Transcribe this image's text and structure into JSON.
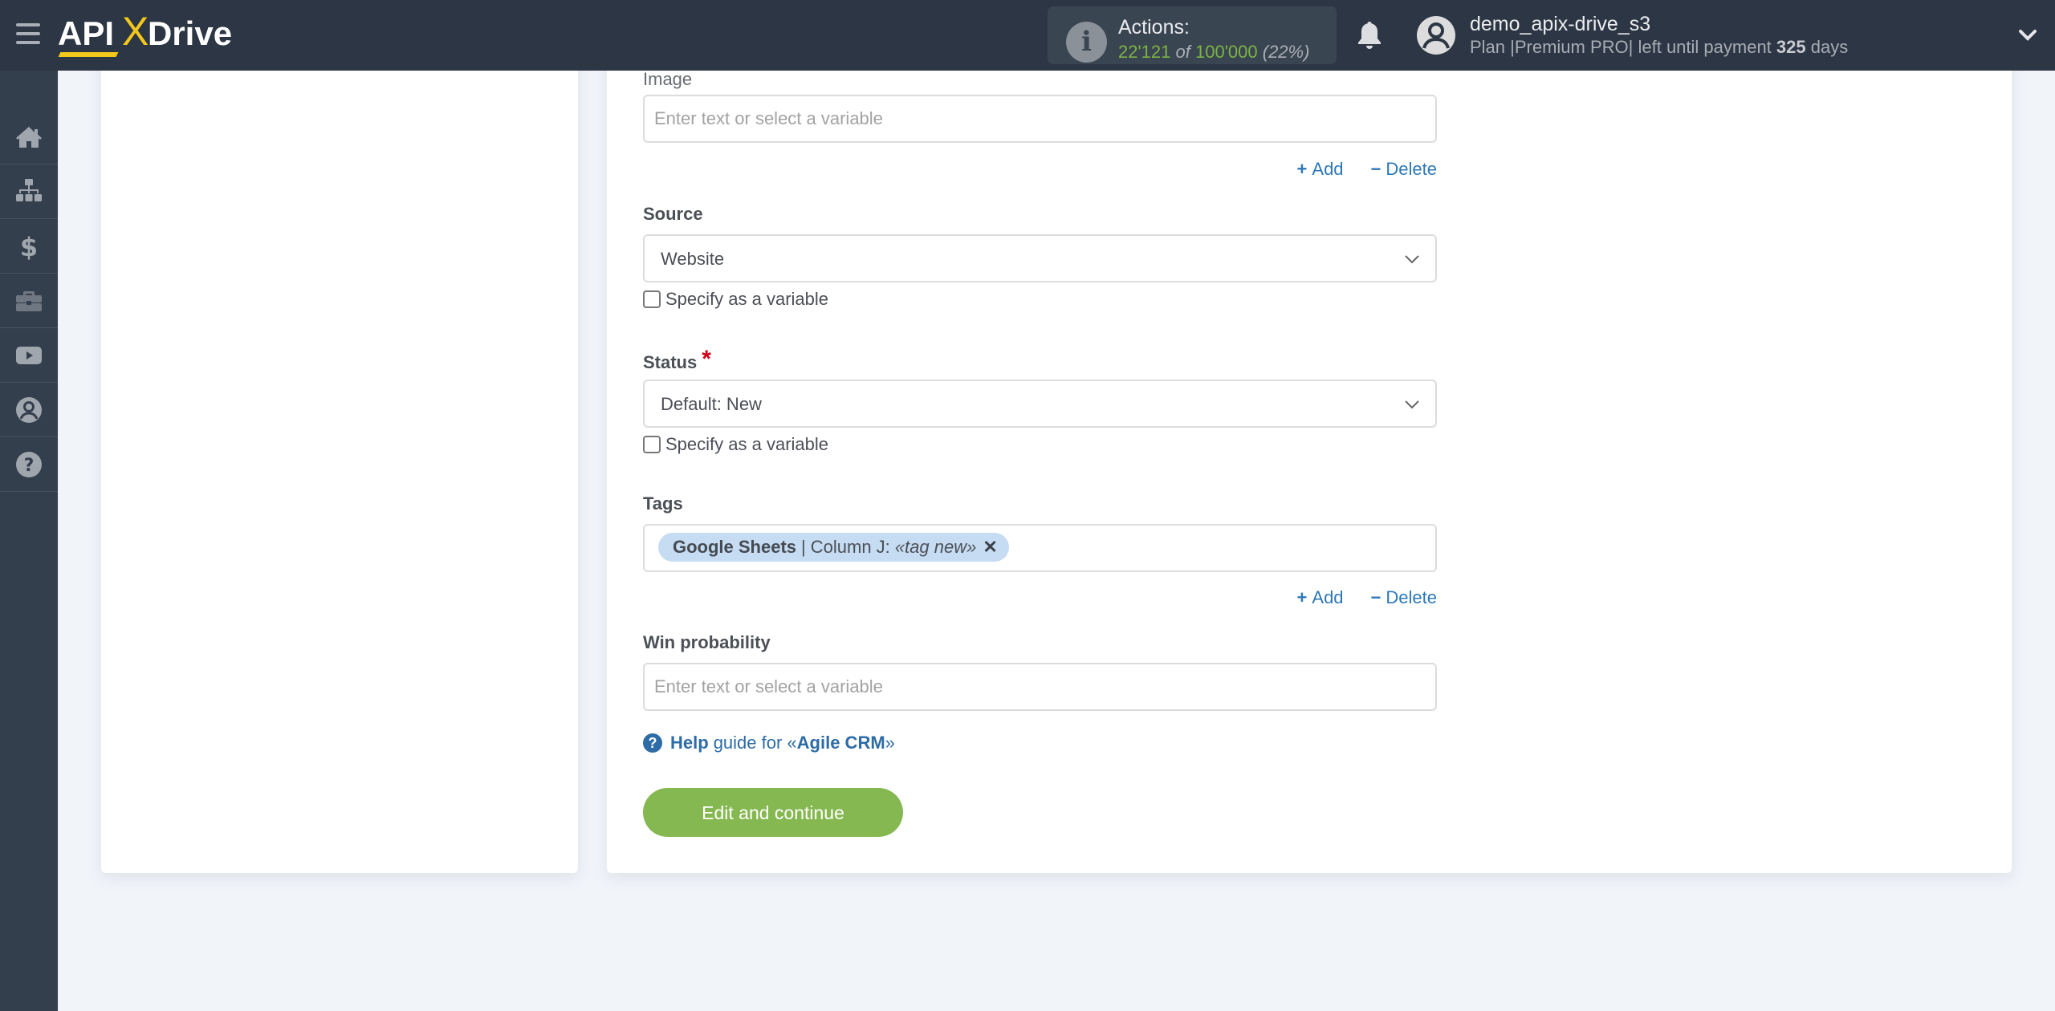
{
  "header": {
    "logo": {
      "part1": "API",
      "x": "X",
      "part2": "Drive"
    },
    "actions": {
      "label": "Actions:",
      "used": "22'121",
      "of": "of",
      "total": "100'000",
      "percent": "(22%)"
    },
    "user": {
      "name": "demo_apix-drive_s3",
      "plan_prefix": "Plan |Premium PRO| left until payment",
      "days_left": "325",
      "days_suffix": "days"
    }
  },
  "sidebar": {
    "items": [
      {
        "name": "home",
        "icon": "home-icon"
      },
      {
        "name": "connections",
        "icon": "sitemap-icon"
      },
      {
        "name": "billing",
        "icon": "dollar-icon"
      },
      {
        "name": "services",
        "icon": "briefcase-icon"
      },
      {
        "name": "videos",
        "icon": "youtube-icon"
      },
      {
        "name": "account",
        "icon": "user-circle-icon"
      },
      {
        "name": "help",
        "icon": "question-circle-icon"
      }
    ]
  },
  "form": {
    "image": {
      "label": "Image",
      "placeholder": "Enter text or select a variable",
      "value": ""
    },
    "add_label": "Add",
    "delete_label": "Delete",
    "source": {
      "label": "Source",
      "value": "Website",
      "checkbox_label": "Specify as a variable",
      "checked": false
    },
    "status": {
      "label": "Status",
      "required_mark": "*",
      "value": "Default: New",
      "checkbox_label": "Specify as a variable",
      "checked": false
    },
    "tags": {
      "label": "Tags",
      "chips": [
        {
          "source": "Google Sheets",
          "separator": "|",
          "field": "Column J:",
          "value": "«tag new»"
        }
      ]
    },
    "win_probability": {
      "label": "Win probability",
      "placeholder": "Enter text or select a variable",
      "value": ""
    },
    "help": {
      "bold": "Help",
      "text": "guide for «",
      "service": "Agile CRM",
      "close": "»"
    },
    "submit_label": "Edit and continue"
  },
  "colors": {
    "header_bg": "#2c3644",
    "sidebar_bg": "#343f4d",
    "accent_green": "#86b851",
    "link_blue": "#2d78b7",
    "logo_yellow": "#f3c81b",
    "tag_bg": "#c6dcf3",
    "required_red": "#d0021b"
  }
}
